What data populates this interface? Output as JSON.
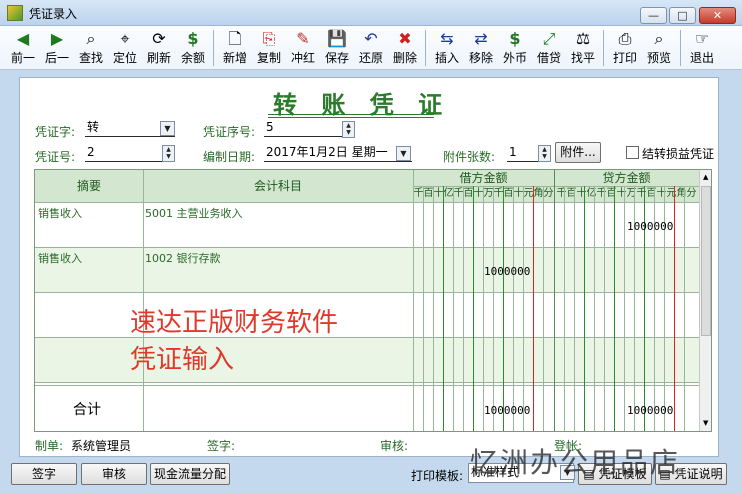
{
  "window": {
    "title": "凭证录入",
    "min": "—",
    "max": "□",
    "close": "✕"
  },
  "toolbar": [
    {
      "label": "前一",
      "icon": "◀"
    },
    {
      "label": "后一",
      "icon": "▶"
    },
    {
      "label": "查找",
      "icon": "⌕"
    },
    {
      "label": "定位",
      "icon": "⌖"
    },
    {
      "label": "刷新",
      "icon": "⟳"
    },
    {
      "label": "余额",
      "icon": "$"
    },
    {
      "label": "新增",
      "icon": "🗋"
    },
    {
      "label": "复制",
      "icon": "⎘"
    },
    {
      "label": "冲红",
      "icon": "✎"
    },
    {
      "label": "保存",
      "icon": "💾"
    },
    {
      "label": "还原",
      "icon": "↶"
    },
    {
      "label": "删除",
      "icon": "✖"
    },
    {
      "label": "插入",
      "icon": "⇆"
    },
    {
      "label": "移除",
      "icon": "⇄"
    },
    {
      "label": "外币",
      "icon": "$"
    },
    {
      "label": "借贷",
      "icon": "⤢"
    },
    {
      "label": "找平",
      "icon": "⚖"
    },
    {
      "label": "打印",
      "icon": "⎙"
    },
    {
      "label": "预览",
      "icon": "⌕"
    },
    {
      "label": "退出",
      "icon": "☞"
    }
  ],
  "voucher": {
    "title": "转 账 凭 证",
    "type_label": "凭证字:",
    "type_value": "转",
    "seq_label": "凭证序号:",
    "seq_value": "5",
    "no_label": "凭证号:",
    "no_value": "2",
    "date_label": "编制日期:",
    "date_value": "2017年1月2日 星期一",
    "attach_label": "附件张数:",
    "attach_value": "1",
    "attach_button": "附件...",
    "carry_label": "结转损益凭证"
  },
  "grid": {
    "col_summary": "摘要",
    "col_account": "会计科目",
    "col_debit": "借方金额",
    "col_credit": "贷方金额",
    "digit_units": "千百十亿千百十万千百十元角分",
    "rows": [
      {
        "summary": "销售收入",
        "account": "5001  主营业务收入",
        "debit": "",
        "credit": "1000000"
      },
      {
        "summary": "销售收入",
        "account": "1002  银行存款",
        "debit": "1000000",
        "credit": ""
      },
      {
        "summary": "",
        "account": "",
        "debit": "",
        "credit": ""
      },
      {
        "summary": "",
        "account": "",
        "debit": "",
        "credit": ""
      }
    ],
    "total_label": "合计",
    "total_debit": "1000000",
    "total_credit": "1000000",
    "overlay_line1": "速达正版财务软件",
    "overlay_line2": "凭证输入"
  },
  "footer": {
    "maker_label": "制单:",
    "maker_value": "系统管理员",
    "sign_label": "签字:",
    "audit_label": "审核:",
    "account_label": "登帐:"
  },
  "bottom": {
    "sign_button": "签字",
    "audit_button": "审核",
    "cashflow_button": "现金流量分配",
    "print_template_label": "打印模板:",
    "print_template_value": "标准样式",
    "template_button": "凭证模板",
    "desc_button": "凭证说明"
  },
  "watermark": "忆洲办公用品店",
  "colors": {
    "accent_green": "#2c7a2c",
    "red_line": "#e02020",
    "overlay_red": "#e0392c"
  }
}
